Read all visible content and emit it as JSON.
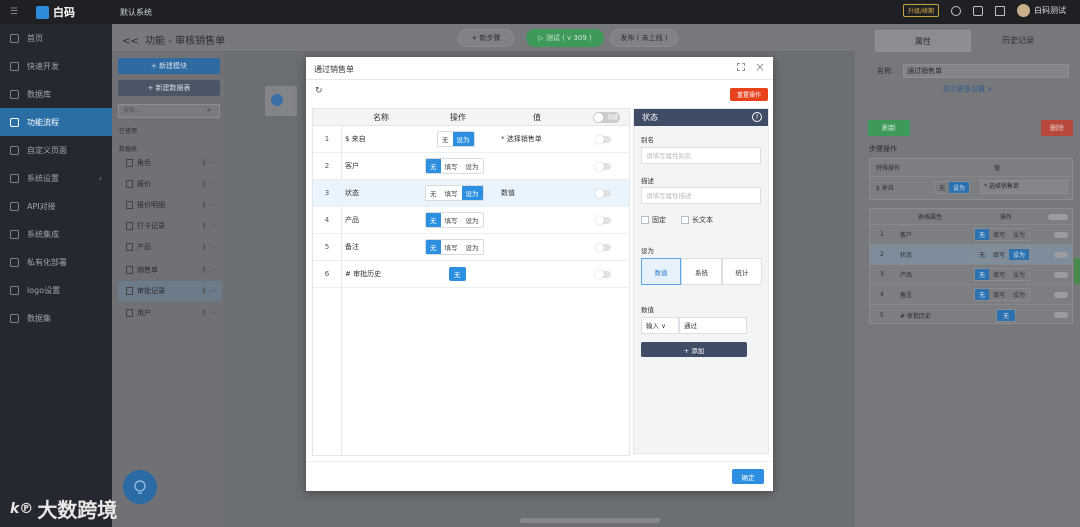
{
  "topbar": {
    "logo": "白码",
    "app_name": "默认系统",
    "upgrade": "升级/续期",
    "user_name": "白码测试"
  },
  "nav": {
    "items": [
      {
        "label": "首页",
        "icon": "home-icon"
      },
      {
        "label": "快速开发",
        "icon": "rocket-icon"
      },
      {
        "label": "数据库",
        "icon": "database-icon"
      },
      {
        "label": "功能流程",
        "icon": "flow-icon",
        "active": true
      },
      {
        "label": "自定义页面",
        "icon": "page-icon"
      },
      {
        "label": "系统设置",
        "icon": "settings-icon",
        "chevron": "›"
      },
      {
        "label": "API对接",
        "icon": "api-icon"
      },
      {
        "label": "系统集成",
        "icon": "integration-icon"
      },
      {
        "label": "私有化部署",
        "icon": "server-icon"
      },
      {
        "label": "logo设置",
        "icon": "image-icon"
      },
      {
        "label": "数据集",
        "icon": "dataset-icon"
      }
    ]
  },
  "header": {
    "back": "<<",
    "breadcrumb": "功能 - 审核销售单",
    "new_step": "+ 新步骤",
    "test": "▷ 测试 ( v 309 )",
    "publish": "发布 ( 未上线 )"
  },
  "left": {
    "new_module": "+ 新建模块",
    "new_table": "+ 新建数据表",
    "search_placeholder": "搜索...",
    "used_label": "已使用",
    "tables_label": "数据表",
    "tables": [
      "角色",
      "报价",
      "报价明细",
      "打卡记录",
      "产品",
      "销售单",
      "审批记录",
      "用户"
    ],
    "selected": "审批记录"
  },
  "right": {
    "tab_props": "属性",
    "tab_history": "历史记录",
    "name_label": "名称:",
    "name_value": "通过销售单",
    "more_settings": "显示更多设置 ∨",
    "refresh": "刷新",
    "delete": "删除",
    "step_ops": "步骤操作",
    "col_special": "特殊操作",
    "col_value": "值",
    "from_label": "$ 来自",
    "op_none": "无",
    "op_setto": "设为",
    "op_fill": "填写",
    "from_value": "* 选择销售单",
    "col_table_prop": "表格属性",
    "col_op": "操作",
    "rows": [
      {
        "idx": "1",
        "name": "客户"
      },
      {
        "idx": "2",
        "name": "状态"
      },
      {
        "idx": "3",
        "name": "产品"
      },
      {
        "idx": "4",
        "name": "备注"
      },
      {
        "idx": "5",
        "name": "# 审批历史"
      }
    ]
  },
  "modal": {
    "title": "通过销售单",
    "refresh": "↻",
    "reset": "重置操作",
    "col_name": "名称",
    "col_op": "操作",
    "col_value": "值",
    "header_switch": "隐藏",
    "rows": [
      {
        "idx": "1",
        "name": "$ 来自",
        "ops": [
          "无",
          "设为"
        ],
        "on": "设为",
        "value": "* 选择销售单"
      },
      {
        "idx": "2",
        "name": "客户",
        "ops": [
          "无",
          "填写",
          "设为"
        ],
        "on": "无",
        "value": ""
      },
      {
        "idx": "3",
        "name": "状态",
        "ops": [
          "无",
          "填写",
          "设为"
        ],
        "on": "设为",
        "value": "数值"
      },
      {
        "idx": "4",
        "name": "产品",
        "ops": [
          "无",
          "填写",
          "设为"
        ],
        "on": "无",
        "value": ""
      },
      {
        "idx": "5",
        "name": "备注",
        "ops": [
          "无",
          "填写",
          "设为"
        ],
        "on": "无",
        "value": ""
      },
      {
        "idx": "6",
        "name": "# 审批历史",
        "ops": [
          "无"
        ],
        "on": "无",
        "value": ""
      }
    ],
    "panel": {
      "title": "状态",
      "alias_label": "别名",
      "alias_placeholder": "请填写属性别名",
      "desc_label": "描述",
      "desc_placeholder": "请填写属性描述",
      "fixed": "固定",
      "long_text": "长文本",
      "setto_label": "设为",
      "tiles": [
        "数值",
        "系统",
        "统计"
      ],
      "tile_on": "数值",
      "value_label": "数值",
      "select": "输入 ∨",
      "value": "通过",
      "add": "+ 添加"
    },
    "ok": "确定"
  },
  "watermark": "大数跨境"
}
